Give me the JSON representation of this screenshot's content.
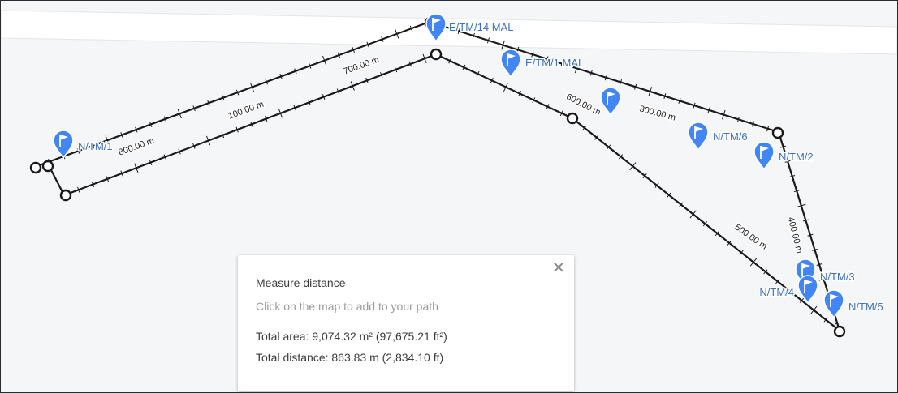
{
  "map": {
    "markers": [
      {
        "label": "E/TM/14 MAL"
      },
      {
        "label": "E/TM/1 MAL"
      },
      {
        "label": "N/TM/1"
      },
      {
        "label": "N/TM/6"
      },
      {
        "label": "N/TM/2"
      },
      {
        "label": "N/TM/3"
      },
      {
        "label": "N/TM/4"
      },
      {
        "label": "N/TM/5"
      },
      {
        "label": ""
      }
    ],
    "distance_labels": [
      "800.00 m",
      "100.00 m",
      "700.00 m",
      "600.00 m",
      "300.00 m",
      "500.00 m",
      "400.00 m"
    ],
    "colors": {
      "background": "#f5f6f8",
      "road": "#ffffff",
      "path": "#1a1a1a",
      "marker": "#4285f4",
      "label": "#3b6fc4"
    },
    "icons": {
      "marker": "map-pin-flag-icon",
      "vertex": "path-vertex-circle-icon",
      "close": "close-icon"
    }
  },
  "panel": {
    "title": "Measure distance",
    "hint": "Click on the map to add to your path",
    "total_area": "Total area: 9,074.32 m² (97,675.21 ft²)",
    "total_distance": "Total distance: 863.83 m (2,834.10 ft)",
    "close_glyph": "✕"
  }
}
